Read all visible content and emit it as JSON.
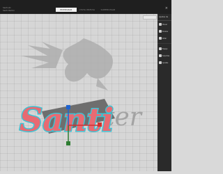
{
  "app": {
    "file_name": "Santi.stl",
    "file_meta": "Santi Remix"
  },
  "tabs": [
    "PREPARAR",
    "VISTA PREVIA",
    "SUPERVISAR"
  ],
  "active_tab": 0,
  "viewport": {
    "model_text": "Santi",
    "bg_text": "ter"
  },
  "right_panel": {
    "title": "Ajustes de",
    "items": [
      "Mover",
      "Escalar",
      "Rotar",
      "Espejo",
      "Soportes",
      "Ajustes"
    ]
  },
  "colors": {
    "model": "#e86a72",
    "outline": "#3fc3d4",
    "axis_x": "#d32f2f",
    "axis_y": "#2e7d32",
    "axis_z": "#1e63d0"
  }
}
